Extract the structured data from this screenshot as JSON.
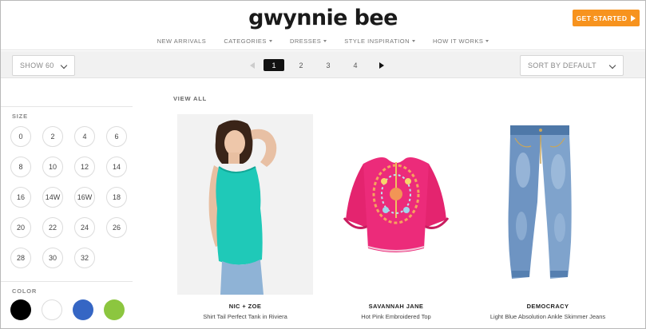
{
  "header": {
    "logo": "gwynnie bee",
    "cta_label": "GET STARTED",
    "nav": [
      {
        "label": "NEW ARRIVALS",
        "has_caret": false
      },
      {
        "label": "CATEGORIES",
        "has_caret": true
      },
      {
        "label": "DRESSES",
        "has_caret": true
      },
      {
        "label": "STYLE INSPIRATION",
        "has_caret": true
      },
      {
        "label": "HOW IT WORKS",
        "has_caret": true
      }
    ],
    "accent_color": "#f7931e"
  },
  "toolbar": {
    "show_value": "SHOW 60",
    "sort_value": "SORT BY DEFAULT",
    "pages": [
      "1",
      "2",
      "3",
      "4"
    ],
    "current_page": "1"
  },
  "filters": {
    "size_title": "SIZE",
    "sizes": [
      "0",
      "2",
      "4",
      "6",
      "8",
      "10",
      "12",
      "14",
      "16",
      "14W",
      "16W",
      "18",
      "20",
      "22",
      "24",
      "26",
      "28",
      "30",
      "32"
    ],
    "color_title": "COLOR",
    "colors": [
      {
        "name": "black",
        "hex": "#000000"
      },
      {
        "name": "white",
        "hex": "#ffffff"
      },
      {
        "name": "blue",
        "hex": "#3566c4"
      },
      {
        "name": "green",
        "hex": "#8cc63f"
      }
    ]
  },
  "main": {
    "view_all": "VIEW ALL",
    "products": [
      {
        "brand": "NIC + ZOE",
        "name": "Shirt Tail Perfect Tank in Riviera",
        "image": "teal-tank-top-model"
      },
      {
        "brand": "SAVANNAH JANE",
        "name": "Hot Pink Embroidered Top",
        "image": "pink-embroidered-blouse"
      },
      {
        "brand": "DEMOCRACY",
        "name": "Light Blue Absolution Ankle Skimmer Jeans",
        "image": "light-blue-jeans"
      }
    ]
  }
}
